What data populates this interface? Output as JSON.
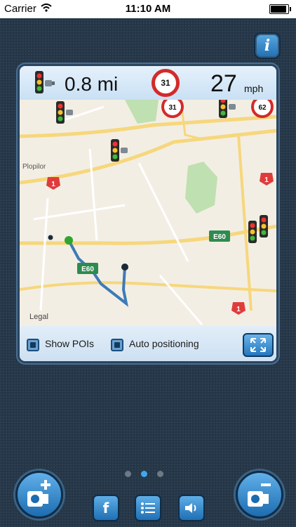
{
  "status_bar": {
    "carrier": "Carrier",
    "time": "11:10 AM",
    "battery_level": 1.0
  },
  "info_button": {
    "label": "i"
  },
  "panel": {
    "distance": "0.8 mi",
    "speed_limit": "31",
    "speed": "27",
    "speed_unit": "mph"
  },
  "map": {
    "labels": {
      "legal": "Legal",
      "place": "Plopilor",
      "road_e60_a": "E60",
      "road_e60_b": "E60",
      "route_1_a": "1",
      "route_1_b": "1",
      "route_1_c": "1",
      "limit_31": "31",
      "limit_62": "62"
    }
  },
  "controls": {
    "show_pois_label": "Show POIs",
    "auto_positioning_label": "Auto positioning"
  },
  "page_indicator": {
    "pages": 3,
    "active": 2
  },
  "bottom_buttons": {
    "facebook_label": "f"
  },
  "colors": {
    "accent": "#2f86d0",
    "speed_limit_ring": "#d42a2a",
    "background": "#243647"
  }
}
